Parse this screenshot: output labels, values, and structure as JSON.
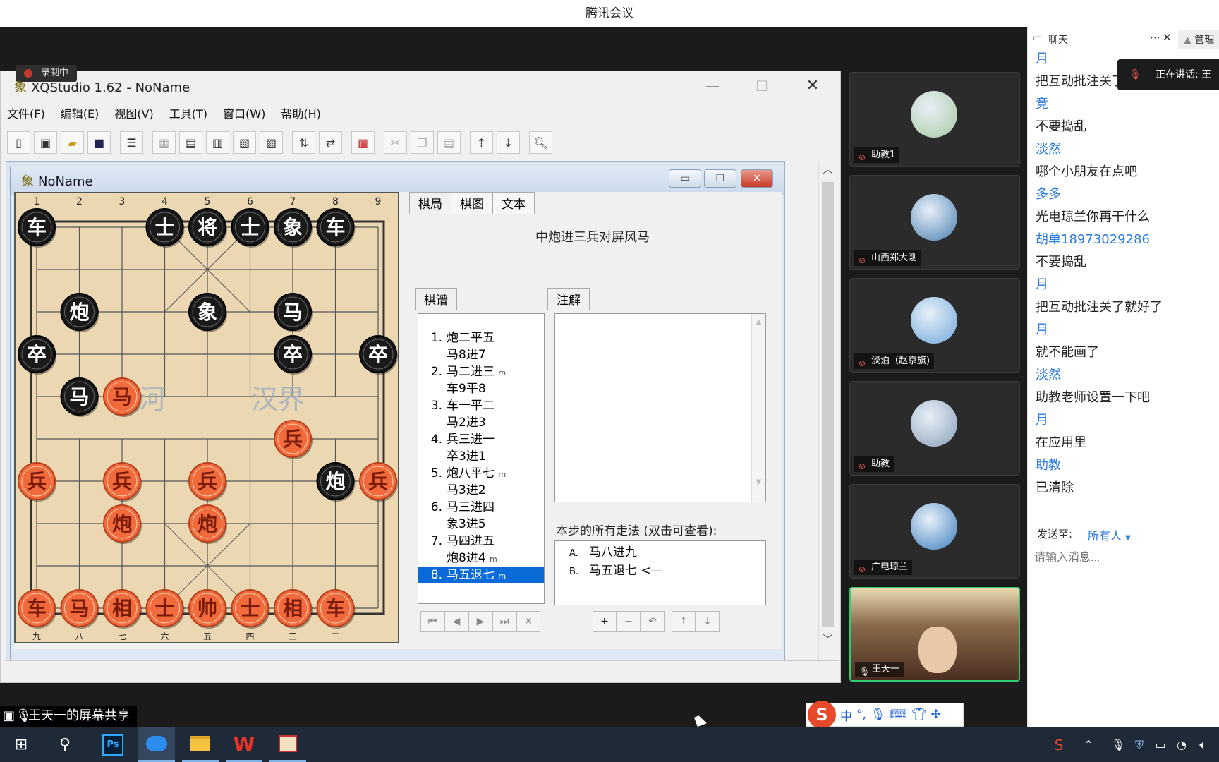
{
  "meeting": {
    "title": "腾讯会议",
    "recording": "录制中",
    "share_label": "王天一的屏幕共享"
  },
  "xq": {
    "title": "XQStudio 1.62 - NoName",
    "menu": [
      "文件(F)",
      "编辑(E)",
      "视图(V)",
      "工具(T)",
      "窗口(W)",
      "帮助(H)"
    ],
    "child_title": "NoName",
    "tabs": [
      "棋局",
      "棋图",
      "文本"
    ],
    "opening": "中炮进三兵对屏风马",
    "record_tab": "棋谱",
    "note_tab": "注解",
    "moves": [
      {
        "n": "1.",
        "red": "炮二平五",
        "black": "马8进7",
        "red_mark": "",
        "black_mark": ""
      },
      {
        "n": "2.",
        "red": "马二进三",
        "black": "车9平8",
        "red_mark": "m",
        "black_mark": ""
      },
      {
        "n": "3.",
        "red": "车一平二",
        "black": "马2进3",
        "red_mark": "",
        "black_mark": ""
      },
      {
        "n": "4.",
        "red": "兵三进一",
        "black": "卒3进1",
        "red_mark": "",
        "black_mark": ""
      },
      {
        "n": "5.",
        "red": "炮八平七",
        "black": "马3进2",
        "red_mark": "m",
        "black_mark": ""
      },
      {
        "n": "6.",
        "red": "马三进四",
        "black": "象3进5",
        "red_mark": "",
        "black_mark": ""
      },
      {
        "n": "7.",
        "red": "马四进五",
        "black": "炮8进4",
        "red_mark": "",
        "black_mark": "m"
      },
      {
        "n": "8.",
        "red": "马五退七",
        "black": "",
        "red_mark": "m",
        "black_mark": ""
      }
    ],
    "variants_label": "本步的所有走法 (双击可查看):",
    "variants": [
      {
        "k": "A.",
        "v": "马八进九"
      },
      {
        "k": "B.",
        "v": "马五退七 <—"
      }
    ],
    "river": [
      "楚河",
      "汉界"
    ],
    "top_files": [
      "1",
      "2",
      "3",
      "4",
      "5",
      "6",
      "7",
      "8",
      "9"
    ],
    "bottom_files": [
      "九",
      "八",
      "七",
      "六",
      "五",
      "四",
      "三",
      "二",
      "一"
    ],
    "pieces": [
      {
        "t": "车",
        "c": "black",
        "f": 0,
        "r": 0
      },
      {
        "t": "士",
        "c": "black",
        "f": 3,
        "r": 0
      },
      {
        "t": "将",
        "c": "black",
        "f": 4,
        "r": 0
      },
      {
        "t": "士",
        "c": "black",
        "f": 5,
        "r": 0
      },
      {
        "t": "象",
        "c": "black",
        "f": 6,
        "r": 0
      },
      {
        "t": "车",
        "c": "black",
        "f": 7,
        "r": 0
      },
      {
        "t": "炮",
        "c": "black",
        "f": 1,
        "r": 2
      },
      {
        "t": "象",
        "c": "black",
        "f": 4,
        "r": 2
      },
      {
        "t": "马",
        "c": "black",
        "f": 6,
        "r": 2
      },
      {
        "t": "卒",
        "c": "black",
        "f": 0,
        "r": 3
      },
      {
        "t": "卒",
        "c": "black",
        "f": 6,
        "r": 3
      },
      {
        "t": "卒",
        "c": "black",
        "f": 8,
        "r": 3
      },
      {
        "t": "马",
        "c": "black",
        "f": 1,
        "r": 4
      },
      {
        "t": "马",
        "c": "red",
        "f": 2,
        "r": 4
      },
      {
        "t": "兵",
        "c": "red",
        "f": 6,
        "r": 5
      },
      {
        "t": "兵",
        "c": "red",
        "f": 0,
        "r": 6
      },
      {
        "t": "兵",
        "c": "red",
        "f": 2,
        "r": 6
      },
      {
        "t": "兵",
        "c": "red",
        "f": 4,
        "r": 6
      },
      {
        "t": "炮",
        "c": "black",
        "f": 7,
        "r": 6
      },
      {
        "t": "兵",
        "c": "red",
        "f": 8,
        "r": 6
      },
      {
        "t": "炮",
        "c": "red",
        "f": 2,
        "r": 7
      },
      {
        "t": "炮",
        "c": "red",
        "f": 4,
        "r": 7
      },
      {
        "t": "车",
        "c": "red",
        "f": 0,
        "r": 9
      },
      {
        "t": "马",
        "c": "red",
        "f": 1,
        "r": 9
      },
      {
        "t": "相",
        "c": "red",
        "f": 2,
        "r": 9
      },
      {
        "t": "士",
        "c": "red",
        "f": 3,
        "r": 9
      },
      {
        "t": "帅",
        "c": "red",
        "f": 4,
        "r": 9
      },
      {
        "t": "士",
        "c": "red",
        "f": 5,
        "r": 9
      },
      {
        "t": "相",
        "c": "red",
        "f": 6,
        "r": 9
      },
      {
        "t": "车",
        "c": "red",
        "f": 7,
        "r": 9
      }
    ]
  },
  "participants": [
    {
      "name": "助教1",
      "avatar": "#a8c8a0"
    },
    {
      "name": "山西郑大刚",
      "avatar": "#4a7fb0"
    },
    {
      "name": "淡泊（赵京旗)",
      "avatar": "#6fa8dc"
    },
    {
      "name": "助教",
      "avatar": "#8aa0b8"
    },
    {
      "name": "广电琼兰",
      "avatar": "#3d7ec0"
    },
    {
      "name": "王天一",
      "avatar": "#6b4a3a"
    }
  ],
  "chat": {
    "tab": "聊天",
    "manage": "管理",
    "speaking": "正在讲话: 王天",
    "messages": [
      {
        "u": "月",
        "m": "把互动批注关了"
      },
      {
        "u": "竞",
        "m": "不要捣乱"
      },
      {
        "u": "淡然",
        "m": "哪个小朋友在点吧"
      },
      {
        "u": "多多",
        "m": "光电琼兰你再干什么"
      },
      {
        "u": "胡单18973029286",
        "m": "不要捣乱"
      },
      {
        "u": "月",
        "m": "把互动批注关了就好了"
      },
      {
        "u": "月",
        "m": "就不能画了"
      },
      {
        "u": "淡然",
        "m": "助教老师设置一下吧"
      },
      {
        "u": "月",
        "m": "在应用里"
      },
      {
        "u": "助教",
        "m": "已清除"
      }
    ],
    "send_to_label": "发送至:",
    "send_to": "所有人",
    "input_placeholder": "请输入消息..."
  },
  "ime": {
    "mode": "中"
  }
}
